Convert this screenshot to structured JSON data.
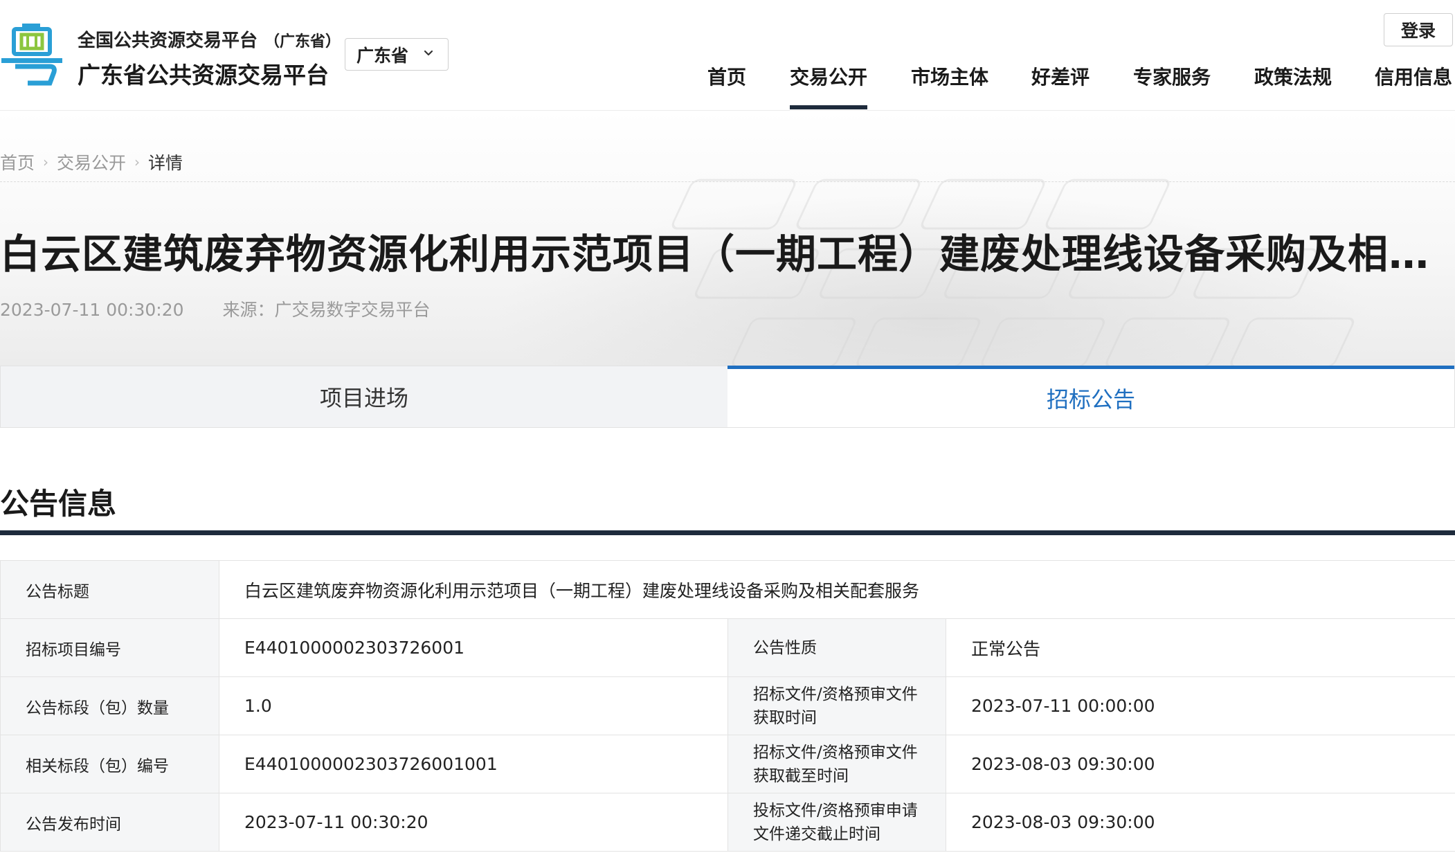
{
  "header": {
    "brand_sub": "全国公共资源交易平台",
    "brand_sub_paren": "（广东省）",
    "brand_main": "广东省公共资源交易平台",
    "region": "广东省",
    "login_label": "登录",
    "nav": [
      {
        "label": "首页",
        "active": false
      },
      {
        "label": "交易公开",
        "active": true
      },
      {
        "label": "市场主体",
        "active": false
      },
      {
        "label": "好差评",
        "active": false
      },
      {
        "label": "专家服务",
        "active": false
      },
      {
        "label": "政策法规",
        "active": false
      },
      {
        "label": "信用信息",
        "active": false
      }
    ]
  },
  "breadcrumb": {
    "home": "首页",
    "section": "交易公开",
    "current": "详情"
  },
  "article": {
    "title": "白云区建筑废弃物资源化利用示范项目（一期工程）建废处理线设备采购及相关配…",
    "date": "2023-07-11 00:30:20",
    "source": "来源：广交易数字交易平台"
  },
  "tabs": [
    {
      "label": "项目进场",
      "active": false
    },
    {
      "label": "招标公告",
      "active": true
    }
  ],
  "section": {
    "title": "公告信息"
  },
  "info": {
    "title_label": "公告标题",
    "title_value": "白云区建筑废弃物资源化利用示范项目（一期工程）建废处理线设备采购及相关配套服务",
    "rows": [
      {
        "l1": "招标项目编号",
        "v1": "E4401000002303726001",
        "l2": "公告性质",
        "v2": "正常公告"
      },
      {
        "l1": "公告标段（包）数量",
        "v1": "1.0",
        "l2": "招标文件/资格预审文件获取时间",
        "v2": "2023-07-11 00:00:00"
      },
      {
        "l1": "相关标段（包）编号",
        "v1": "E4401000002303726001001",
        "l2": "招标文件/资格预审文件获取截至时间",
        "v2": "2023-08-03 09:30:00"
      },
      {
        "l1": "公告发布时间",
        "v1": "2023-07-11 00:30:20",
        "l2": "投标文件/资格预审申请文件递交截止时间",
        "v2": "2023-08-03 09:30:00"
      }
    ]
  },
  "colors": {
    "accent": "#1f6fc0",
    "nav_underline": "#1e2b3c",
    "logo_blue": "#2a9fd6",
    "logo_green": "#8cc63f"
  }
}
